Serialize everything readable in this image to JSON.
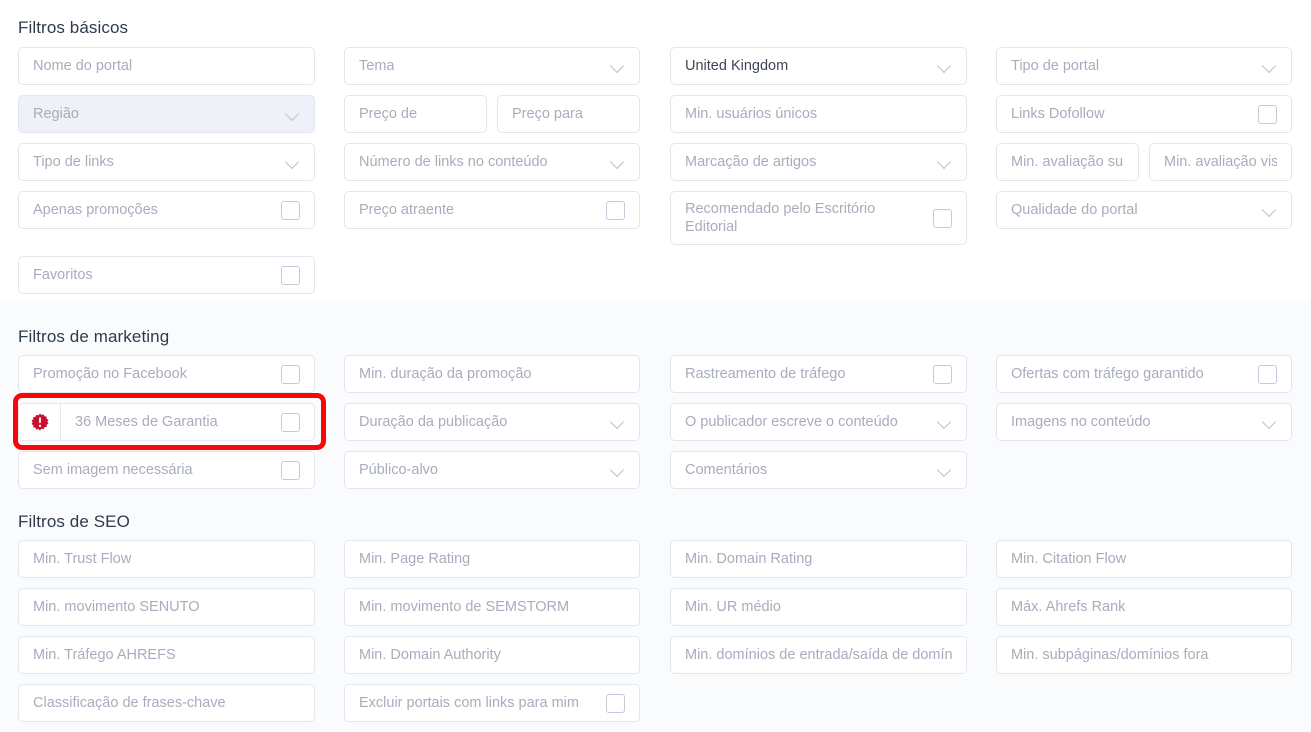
{
  "sections": [
    {
      "id": "basic",
      "title": "Filtros básicos",
      "fields": [
        {
          "label": "Nome do portal",
          "control": "text"
        },
        {
          "label": "Tema",
          "control": "select"
        },
        {
          "label": "United Kingdom",
          "control": "select",
          "state": "filled"
        },
        {
          "label": "Tipo de portal",
          "control": "select"
        },
        {
          "label": "Região",
          "control": "select",
          "state": "disabled"
        },
        {
          "label": "Preço de",
          "control": "text"
        },
        {
          "label": "Preço para",
          "control": "text"
        },
        {
          "label": "Min. usuários únicos",
          "control": "text"
        },
        {
          "label": "Links Dofollow",
          "control": "checkbox"
        },
        {
          "label": "Tipo de links",
          "control": "select"
        },
        {
          "label": "Número de links no conteúdo",
          "control": "select"
        },
        {
          "label": "Marcação de artigos",
          "control": "select"
        },
        {
          "label": "Min. avaliação sub",
          "control": "text"
        },
        {
          "label": "Min. avaliação visu",
          "control": "text"
        },
        {
          "label": "Apenas promoções",
          "control": "checkbox"
        },
        {
          "label": "Preço atraente",
          "control": "checkbox"
        },
        {
          "label": "Recomendado pelo Escritório Editorial",
          "control": "checkbox"
        },
        {
          "label": "Qualidade do portal",
          "control": "select"
        },
        {
          "label": "Favoritos",
          "control": "checkbox"
        }
      ]
    },
    {
      "id": "marketing",
      "title": "Filtros de marketing",
      "fields": [
        {
          "label": "Promoção no Facebook",
          "control": "checkbox"
        },
        {
          "label": "Min. duração da promoção",
          "control": "text"
        },
        {
          "label": "Rastreamento de tráfego",
          "control": "checkbox"
        },
        {
          "label": "Ofertas com tráfego garantido",
          "control": "checkbox"
        },
        {
          "label": "36 Meses de Garantia",
          "control": "checkbox",
          "prefix_icon": "warning-badge-icon"
        },
        {
          "label": "Duração da publicação",
          "control": "select"
        },
        {
          "label": "O publicador escreve o conteúdo",
          "control": "select"
        },
        {
          "label": "Imagens no conteúdo",
          "control": "select"
        },
        {
          "label": "Sem imagem necessária",
          "control": "checkbox"
        },
        {
          "label": "Público-alvo",
          "control": "select"
        },
        {
          "label": "Comentários",
          "control": "select"
        }
      ]
    },
    {
      "id": "seo",
      "title": "Filtros de SEO",
      "fields": [
        {
          "label": "Min. Trust Flow",
          "control": "text"
        },
        {
          "label": "Min. Page Rating",
          "control": "text"
        },
        {
          "label": "Min. Domain Rating",
          "control": "text"
        },
        {
          "label": "Min. Citation Flow",
          "control": "text"
        },
        {
          "label": "Min. movimento SENUTO",
          "control": "text"
        },
        {
          "label": "Min. movimento de SEMSTORM",
          "control": "text"
        },
        {
          "label": "Min. UR médio",
          "control": "text"
        },
        {
          "label": "Máx. Ahrefs Rank",
          "control": "text"
        },
        {
          "label": "Min. Tráfego AHREFS",
          "control": "text"
        },
        {
          "label": "Min. Domain Authority",
          "control": "text"
        },
        {
          "label": "Min. domínios de entrada/saída de domínio",
          "control": "text"
        },
        {
          "label": "Min. subpáginas/domínios fora",
          "control": "text"
        },
        {
          "label": "Classificação de frases-chave",
          "control": "text"
        },
        {
          "label": "Excluir portais com links para mim",
          "control": "checkbox"
        }
      ]
    }
  ],
  "highlight": {
    "target_label": "36 Meses de Garantia",
    "color": "#fb0606"
  },
  "colors": {
    "placeholder_text": "#a7adbd",
    "filled_text": "#3d4657",
    "field_border": "#e2e6ef",
    "section_heading": "#2e3a4d",
    "disabled_field_bg": "#eef1f7",
    "section_alt_bg": "#fafbfc",
    "warning_badge": "#c8102e",
    "highlight_outline": "#fb0606"
  }
}
